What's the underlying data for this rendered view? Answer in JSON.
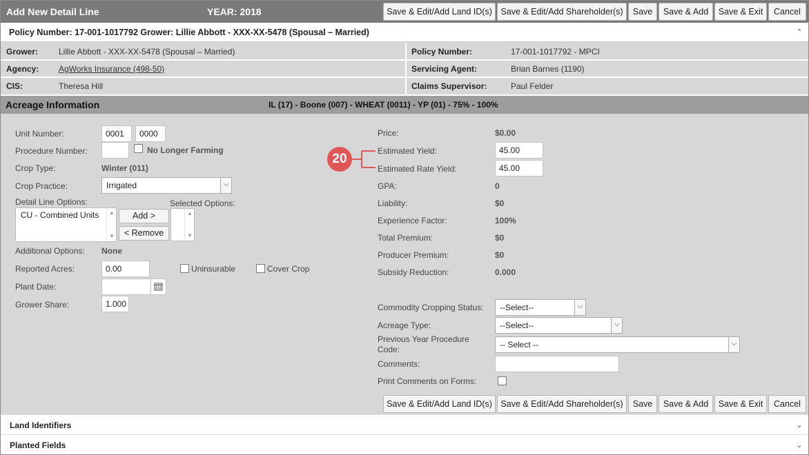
{
  "header": {
    "title": "Add New Detail Line",
    "year": "YEAR: 2018"
  },
  "actions": {
    "save_edit_land": "Save & Edit/Add Land ID(s)",
    "save_edit_shareholder": "Save & Edit/Add Shareholder(s)",
    "save": "Save",
    "save_add": "Save & Add",
    "save_exit": "Save & Exit",
    "cancel": "Cancel"
  },
  "policy_bar": {
    "label": "Policy Number: 17-001-1017792 Grower: Lillie Abbott - XXX-XX-5478 (Spousal – Married)"
  },
  "info": {
    "grower_label": "Grower:",
    "grower_value": "Lillie Abbott - XXX-XX-5478 (Spousal – Married)",
    "agency_label": "Agency:",
    "agency_value": "AgWorks Insurance (498-50)",
    "cis_label": "CIS:",
    "cis_value": "Theresa Hill",
    "policy_label": "Policy Number:",
    "policy_value": "17-001-1017792 - MPCI",
    "agent_label": "Servicing Agent:",
    "agent_value": "Brian Barnes (1190)",
    "supervisor_label": "Claims Supervisor:",
    "supervisor_value": "Paul Felder"
  },
  "acreage": {
    "title": "Acreage Information",
    "summary": "IL (17) - Boone (007) - WHEAT (0011) - YP (01) - 75% - 100%"
  },
  "left": {
    "unit_number_label": "Unit Number:",
    "unit_number_1": "0001",
    "unit_number_2": "0000",
    "procedure_number_label": "Procedure Number:",
    "procedure_number": "",
    "no_longer_farming": "No Longer Farming",
    "crop_type_label": "Crop Type:",
    "crop_type": "Winter (011)",
    "crop_practice_label": "Crop Practice:",
    "crop_practice": "Irrigated",
    "detail_line_options_label": "Detail Line Options:",
    "detail_line_options": [
      "CU - Combined Units"
    ],
    "selected_options_label": "Selected Options:",
    "add_button": "Add >",
    "remove_button": "< Remove",
    "additional_options_label": "Additional Options:",
    "additional_options": "None",
    "reported_acres_label": "Reported Acres:",
    "reported_acres": "0.00",
    "uninsurable": "Uninsurable",
    "cover_crop": "Cover Crop",
    "plant_date_label": "Plant Date:",
    "plant_date": "",
    "grower_share_label": "Grower Share:",
    "grower_share": "1.000"
  },
  "right": {
    "price_label": "Price:",
    "price": "$0.00",
    "estimated_yield_label": "Estimated Yield:",
    "estimated_yield": "45.00",
    "estimated_rate_yield_label": "Estimated Rate Yield:",
    "estimated_rate_yield": "45.00",
    "gpa_label": "GPA:",
    "gpa": "0",
    "liability_label": "Liability:",
    "liability": "$0",
    "experience_factor_label": "Experience Factor:",
    "experience_factor": "100%",
    "total_premium_label": "Total Premium:",
    "total_premium": "$0",
    "producer_premium_label": "Producer Premium:",
    "producer_premium": "$0",
    "subsidy_reduction_label": "Subsidy Reduction:",
    "subsidy_reduction": "0.000",
    "commodity_status_label": "Commodity Cropping Status:",
    "commodity_status": "--Select--",
    "acreage_type_label": "Acreage Type:",
    "acreage_type": "--Select--",
    "prev_year_label_1": "Previous Year Procedure",
    "prev_year_label_2": "Code:",
    "prev_year": "-- Select --",
    "comments_label": "Comments:",
    "comments": "",
    "print_comments_label": "Print Comments on Forms:"
  },
  "callout": {
    "number": "20",
    "color": "#e05757"
  },
  "sections": {
    "land_identifiers": "Land Identifiers",
    "planted_fields": "Planted Fields"
  },
  "icons": {
    "collapse": "chevron-up-icon",
    "expand": "chevron-down-icon",
    "calendar": "calendar-icon"
  }
}
